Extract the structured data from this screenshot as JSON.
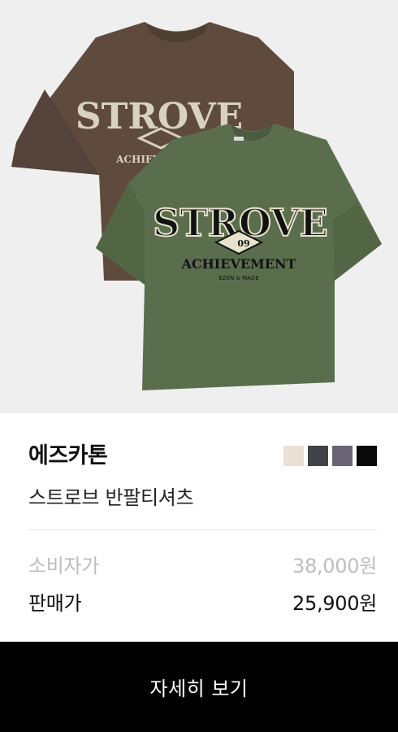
{
  "product": {
    "brand": "에즈카톤",
    "name": "스트로브 반팔티셔츠",
    "image_alt": "STROVE ACHIEVEMENT 반팔티셔츠 브라운, 카키",
    "print": {
      "word": "STROVE",
      "badge": "09",
      "sub": "ACHIEVEMENT",
      "small": "EZKN & MADE"
    }
  },
  "swatches": [
    {
      "name": "ivory",
      "color": "#e8e1d4"
    },
    {
      "name": "charcoal",
      "color": "#404246"
    },
    {
      "name": "purple-gray",
      "color": "#6a6474"
    },
    {
      "name": "black",
      "color": "#0a0a0a"
    }
  ],
  "prices": {
    "consumer_label": "소비자가",
    "consumer_value": "38,000원",
    "sale_label": "판매가",
    "sale_value": "25,900원"
  },
  "button": {
    "label": "자세히 보기"
  }
}
